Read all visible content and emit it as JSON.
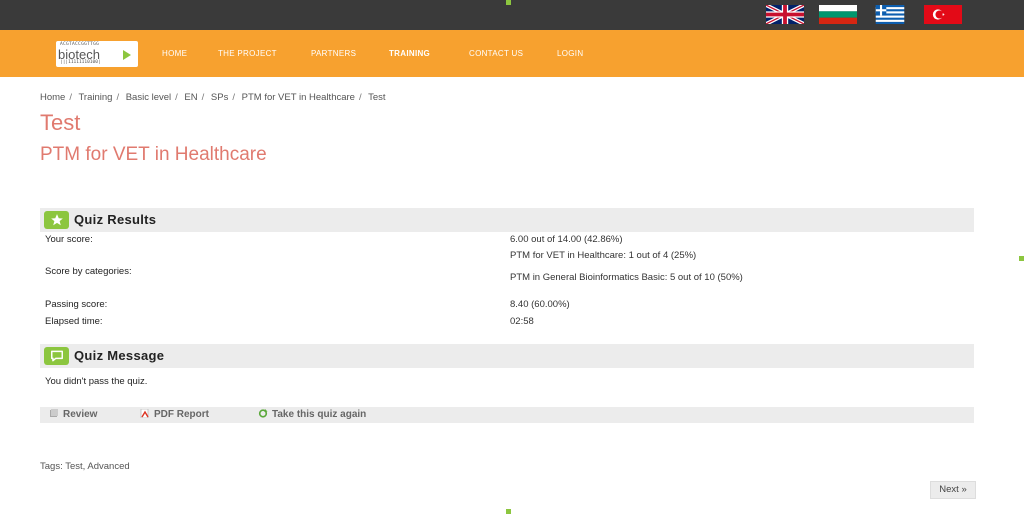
{
  "languages": [
    "English",
    "Bulgarian",
    "Greek",
    "Turkish"
  ],
  "logo": {
    "top_text": "ACGTACCGGTTGG",
    "word": "biotech",
    "bottom_text": "|||11111110100|"
  },
  "nav": {
    "items": [
      "HOME",
      "THE PROJECT",
      "PARTNERS",
      "TRAINING",
      "CONTACT US",
      "LOGIN"
    ],
    "active": "TRAINING"
  },
  "breadcrumb": [
    "Home",
    "Training",
    "Basic level",
    "EN",
    "SPs",
    "PTM for VET in Healthcare",
    "Test"
  ],
  "page": {
    "title": "Test",
    "subtitle": "PTM for VET in Healthcare"
  },
  "results": {
    "heading": "Quiz Results",
    "your_score_label": "Your score:",
    "your_score_value": "6.00 out of 14.00 (42.86%)",
    "categories_label": "Score by categories:",
    "categories": [
      "PTM for VET in Healthcare: 1 out of 4 (25%)",
      "PTM in General Bioinformatics Basic: 5 out of 10 (50%)"
    ],
    "passing_label": "Passing score:",
    "passing_value": "8.40 (60.00%)",
    "elapsed_label": "Elapsed time:",
    "elapsed_value": "02:58"
  },
  "message": {
    "heading": "Quiz Message",
    "text": "You didn't pass the quiz."
  },
  "actions": {
    "review": "Review",
    "pdf": "PDF Report",
    "retake": "Take this quiz again"
  },
  "tags": {
    "label": "Tags:",
    "items": [
      "Test",
      "Advanced"
    ]
  },
  "pager": {
    "next": "Next »"
  },
  "colors": {
    "topbar": "#3a3a3a",
    "header": "#f7a12f",
    "title": "#e07a6f",
    "accent_green": "#8cc63f",
    "section_bg": "#ececec"
  }
}
